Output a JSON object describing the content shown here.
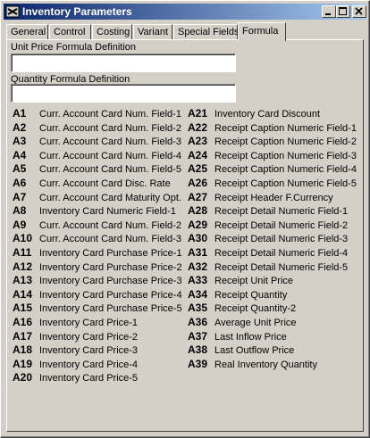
{
  "window": {
    "title": "Inventory Parameters",
    "title_bar_color": "#0a246a",
    "buttons": {
      "minimize": "minimize-icon",
      "maximize": "maximize-icon",
      "close": "close-icon"
    }
  },
  "tabs": [
    {
      "label": "General"
    },
    {
      "label": "Control"
    },
    {
      "label": "Costing"
    },
    {
      "label": "Variant"
    },
    {
      "label": "Special Fields"
    },
    {
      "label": "Formula",
      "active": true
    }
  ],
  "form": {
    "unit_price_label": "Unit Price Formula Definition",
    "unit_price_value": "",
    "quantity_label": "Quantity Formula Definition",
    "quantity_value": ""
  },
  "codes_left": [
    {
      "code": "A1",
      "desc": "Curr. Account Card Num. Field-1"
    },
    {
      "code": "A2",
      "desc": "Curr. Account Card Num. Field-2"
    },
    {
      "code": "A3",
      "desc": "Curr. Account Card Num. Field-3"
    },
    {
      "code": "A4",
      "desc": "Curr. Account Card Num. Field-4"
    },
    {
      "code": "A5",
      "desc": "Curr. Account Card Num. Field-5"
    },
    {
      "code": "A6",
      "desc": "Curr. Account Card Disc. Rate"
    },
    {
      "code": "A7",
      "desc": "Curr. Account Card Maturity Opt."
    },
    {
      "code": "A8",
      "desc": "Inventory Card Numeric Field-1"
    },
    {
      "code": "A9",
      "desc": "Curr. Account Card Num. Field-2"
    },
    {
      "code": "A10",
      "desc": "Curr. Account Card Num. Field-3"
    },
    {
      "code": "A11",
      "desc": "Inventory Card Purchase Price-1"
    },
    {
      "code": "A12",
      "desc": "Inventory Card Purchase Price-2"
    },
    {
      "code": "A13",
      "desc": "Inventory Card Purchase Price-3"
    },
    {
      "code": "A14",
      "desc": "Inventory Card Purchase Price-4"
    },
    {
      "code": "A15",
      "desc": "Inventory Card Purchase Price-5"
    },
    {
      "code": "A16",
      "desc": "Inventory Card Price-1"
    },
    {
      "code": "A17",
      "desc": "Inventory Card Price-2"
    },
    {
      "code": "A18",
      "desc": "Inventory Card Price-3"
    },
    {
      "code": "A19",
      "desc": "Inventory Card Price-4"
    },
    {
      "code": "A20",
      "desc": "Inventory Card Price-5"
    }
  ],
  "codes_right": [
    {
      "code": "A21",
      "desc": "Inventory Card Discount"
    },
    {
      "code": "A22",
      "desc": "Receipt Caption Numeric Field-1"
    },
    {
      "code": "A23",
      "desc": "Receipt Caption Numeric Field-2"
    },
    {
      "code": "A24",
      "desc": "Receipt Caption Numeric Field-3"
    },
    {
      "code": "A25",
      "desc": "Receipt Caption Numeric Field-4"
    },
    {
      "code": "A26",
      "desc": "Receipt Caption Numeric Field-5"
    },
    {
      "code": "A27",
      "desc": "Receipt Header F.Currency"
    },
    {
      "code": "A28",
      "desc": "Receipt Detail Numeric Field-1"
    },
    {
      "code": "A29",
      "desc": "Receipt Detail Numeric Field-2"
    },
    {
      "code": "A30",
      "desc": "Receipt Detail Numeric Field-3"
    },
    {
      "code": "A31",
      "desc": "Receipt Detail Numeric Field-4"
    },
    {
      "code": "A32",
      "desc": "Receipt Detail Numeric Field-5"
    },
    {
      "code": "A33",
      "desc": "Receipt Unit Price"
    },
    {
      "code": "A34",
      "desc": "Receipt Quantity"
    },
    {
      "code": "A35",
      "desc": "Receipt Quantity-2"
    },
    {
      "code": "A36",
      "desc": "Average Unit Price"
    },
    {
      "code": "A37",
      "desc": "Last Inflow Price"
    },
    {
      "code": "A38",
      "desc": "Last Outflow Price"
    },
    {
      "code": "A39",
      "desc": "Real Inventory Quantity"
    }
  ]
}
